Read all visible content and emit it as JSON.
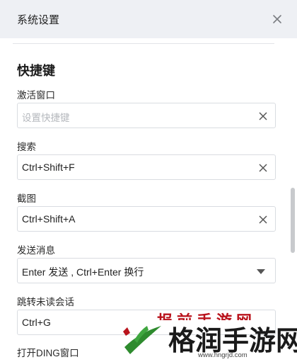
{
  "window": {
    "title": "系统设置",
    "close_icon": "close-icon"
  },
  "section": {
    "title": "快捷键"
  },
  "shortcuts": [
    {
      "label": "激活窗口",
      "value": "",
      "placeholder": "设置快捷键",
      "clear_icon": "clear-icon"
    },
    {
      "label": "搜索",
      "value": "Ctrl+Shift+F",
      "placeholder": "",
      "clear_icon": "clear-icon"
    },
    {
      "label": "截图",
      "value": "Ctrl+Shift+A",
      "placeholder": "",
      "clear_icon": "clear-icon"
    },
    {
      "label": "发送消息",
      "value": "Enter 发送 , Ctrl+Enter 换行",
      "dropdown_icon": "chevron-down-icon"
    },
    {
      "label": "跳转未读会话",
      "value": "Ctrl+G"
    },
    {
      "label": "打开DING窗口"
    }
  ],
  "watermark": {
    "top_text": "报前手游网",
    "big_text": "格润手游网",
    "url": "www.hngrjd.com",
    "colors": {
      "red": "#b9131c",
      "green": "#2e8b2e",
      "dark": "#1a1a1a"
    }
  }
}
